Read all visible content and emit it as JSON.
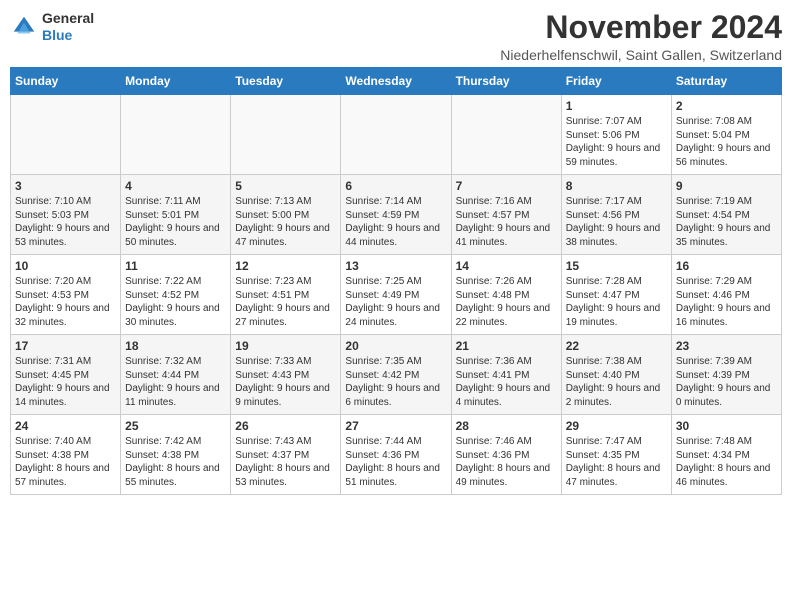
{
  "header": {
    "logo_line1": "General",
    "logo_line2": "Blue",
    "month_title": "November 2024",
    "location": "Niederhelfenschwil, Saint Gallen, Switzerland"
  },
  "days_of_week": [
    "Sunday",
    "Monday",
    "Tuesday",
    "Wednesday",
    "Thursday",
    "Friday",
    "Saturday"
  ],
  "weeks": [
    [
      {
        "day": "",
        "info": ""
      },
      {
        "day": "",
        "info": ""
      },
      {
        "day": "",
        "info": ""
      },
      {
        "day": "",
        "info": ""
      },
      {
        "day": "",
        "info": ""
      },
      {
        "day": "1",
        "info": "Sunrise: 7:07 AM\nSunset: 5:06 PM\nDaylight: 9 hours and 59 minutes."
      },
      {
        "day": "2",
        "info": "Sunrise: 7:08 AM\nSunset: 5:04 PM\nDaylight: 9 hours and 56 minutes."
      }
    ],
    [
      {
        "day": "3",
        "info": "Sunrise: 7:10 AM\nSunset: 5:03 PM\nDaylight: 9 hours and 53 minutes."
      },
      {
        "day": "4",
        "info": "Sunrise: 7:11 AM\nSunset: 5:01 PM\nDaylight: 9 hours and 50 minutes."
      },
      {
        "day": "5",
        "info": "Sunrise: 7:13 AM\nSunset: 5:00 PM\nDaylight: 9 hours and 47 minutes."
      },
      {
        "day": "6",
        "info": "Sunrise: 7:14 AM\nSunset: 4:59 PM\nDaylight: 9 hours and 44 minutes."
      },
      {
        "day": "7",
        "info": "Sunrise: 7:16 AM\nSunset: 4:57 PM\nDaylight: 9 hours and 41 minutes."
      },
      {
        "day": "8",
        "info": "Sunrise: 7:17 AM\nSunset: 4:56 PM\nDaylight: 9 hours and 38 minutes."
      },
      {
        "day": "9",
        "info": "Sunrise: 7:19 AM\nSunset: 4:54 PM\nDaylight: 9 hours and 35 minutes."
      }
    ],
    [
      {
        "day": "10",
        "info": "Sunrise: 7:20 AM\nSunset: 4:53 PM\nDaylight: 9 hours and 32 minutes."
      },
      {
        "day": "11",
        "info": "Sunrise: 7:22 AM\nSunset: 4:52 PM\nDaylight: 9 hours and 30 minutes."
      },
      {
        "day": "12",
        "info": "Sunrise: 7:23 AM\nSunset: 4:51 PM\nDaylight: 9 hours and 27 minutes."
      },
      {
        "day": "13",
        "info": "Sunrise: 7:25 AM\nSunset: 4:49 PM\nDaylight: 9 hours and 24 minutes."
      },
      {
        "day": "14",
        "info": "Sunrise: 7:26 AM\nSunset: 4:48 PM\nDaylight: 9 hours and 22 minutes."
      },
      {
        "day": "15",
        "info": "Sunrise: 7:28 AM\nSunset: 4:47 PM\nDaylight: 9 hours and 19 minutes."
      },
      {
        "day": "16",
        "info": "Sunrise: 7:29 AM\nSunset: 4:46 PM\nDaylight: 9 hours and 16 minutes."
      }
    ],
    [
      {
        "day": "17",
        "info": "Sunrise: 7:31 AM\nSunset: 4:45 PM\nDaylight: 9 hours and 14 minutes."
      },
      {
        "day": "18",
        "info": "Sunrise: 7:32 AM\nSunset: 4:44 PM\nDaylight: 9 hours and 11 minutes."
      },
      {
        "day": "19",
        "info": "Sunrise: 7:33 AM\nSunset: 4:43 PM\nDaylight: 9 hours and 9 minutes."
      },
      {
        "day": "20",
        "info": "Sunrise: 7:35 AM\nSunset: 4:42 PM\nDaylight: 9 hours and 6 minutes."
      },
      {
        "day": "21",
        "info": "Sunrise: 7:36 AM\nSunset: 4:41 PM\nDaylight: 9 hours and 4 minutes."
      },
      {
        "day": "22",
        "info": "Sunrise: 7:38 AM\nSunset: 4:40 PM\nDaylight: 9 hours and 2 minutes."
      },
      {
        "day": "23",
        "info": "Sunrise: 7:39 AM\nSunset: 4:39 PM\nDaylight: 9 hours and 0 minutes."
      }
    ],
    [
      {
        "day": "24",
        "info": "Sunrise: 7:40 AM\nSunset: 4:38 PM\nDaylight: 8 hours and 57 minutes."
      },
      {
        "day": "25",
        "info": "Sunrise: 7:42 AM\nSunset: 4:38 PM\nDaylight: 8 hours and 55 minutes."
      },
      {
        "day": "26",
        "info": "Sunrise: 7:43 AM\nSunset: 4:37 PM\nDaylight: 8 hours and 53 minutes."
      },
      {
        "day": "27",
        "info": "Sunrise: 7:44 AM\nSunset: 4:36 PM\nDaylight: 8 hours and 51 minutes."
      },
      {
        "day": "28",
        "info": "Sunrise: 7:46 AM\nSunset: 4:36 PM\nDaylight: 8 hours and 49 minutes."
      },
      {
        "day": "29",
        "info": "Sunrise: 7:47 AM\nSunset: 4:35 PM\nDaylight: 8 hours and 47 minutes."
      },
      {
        "day": "30",
        "info": "Sunrise: 7:48 AM\nSunset: 4:34 PM\nDaylight: 8 hours and 46 minutes."
      }
    ]
  ]
}
